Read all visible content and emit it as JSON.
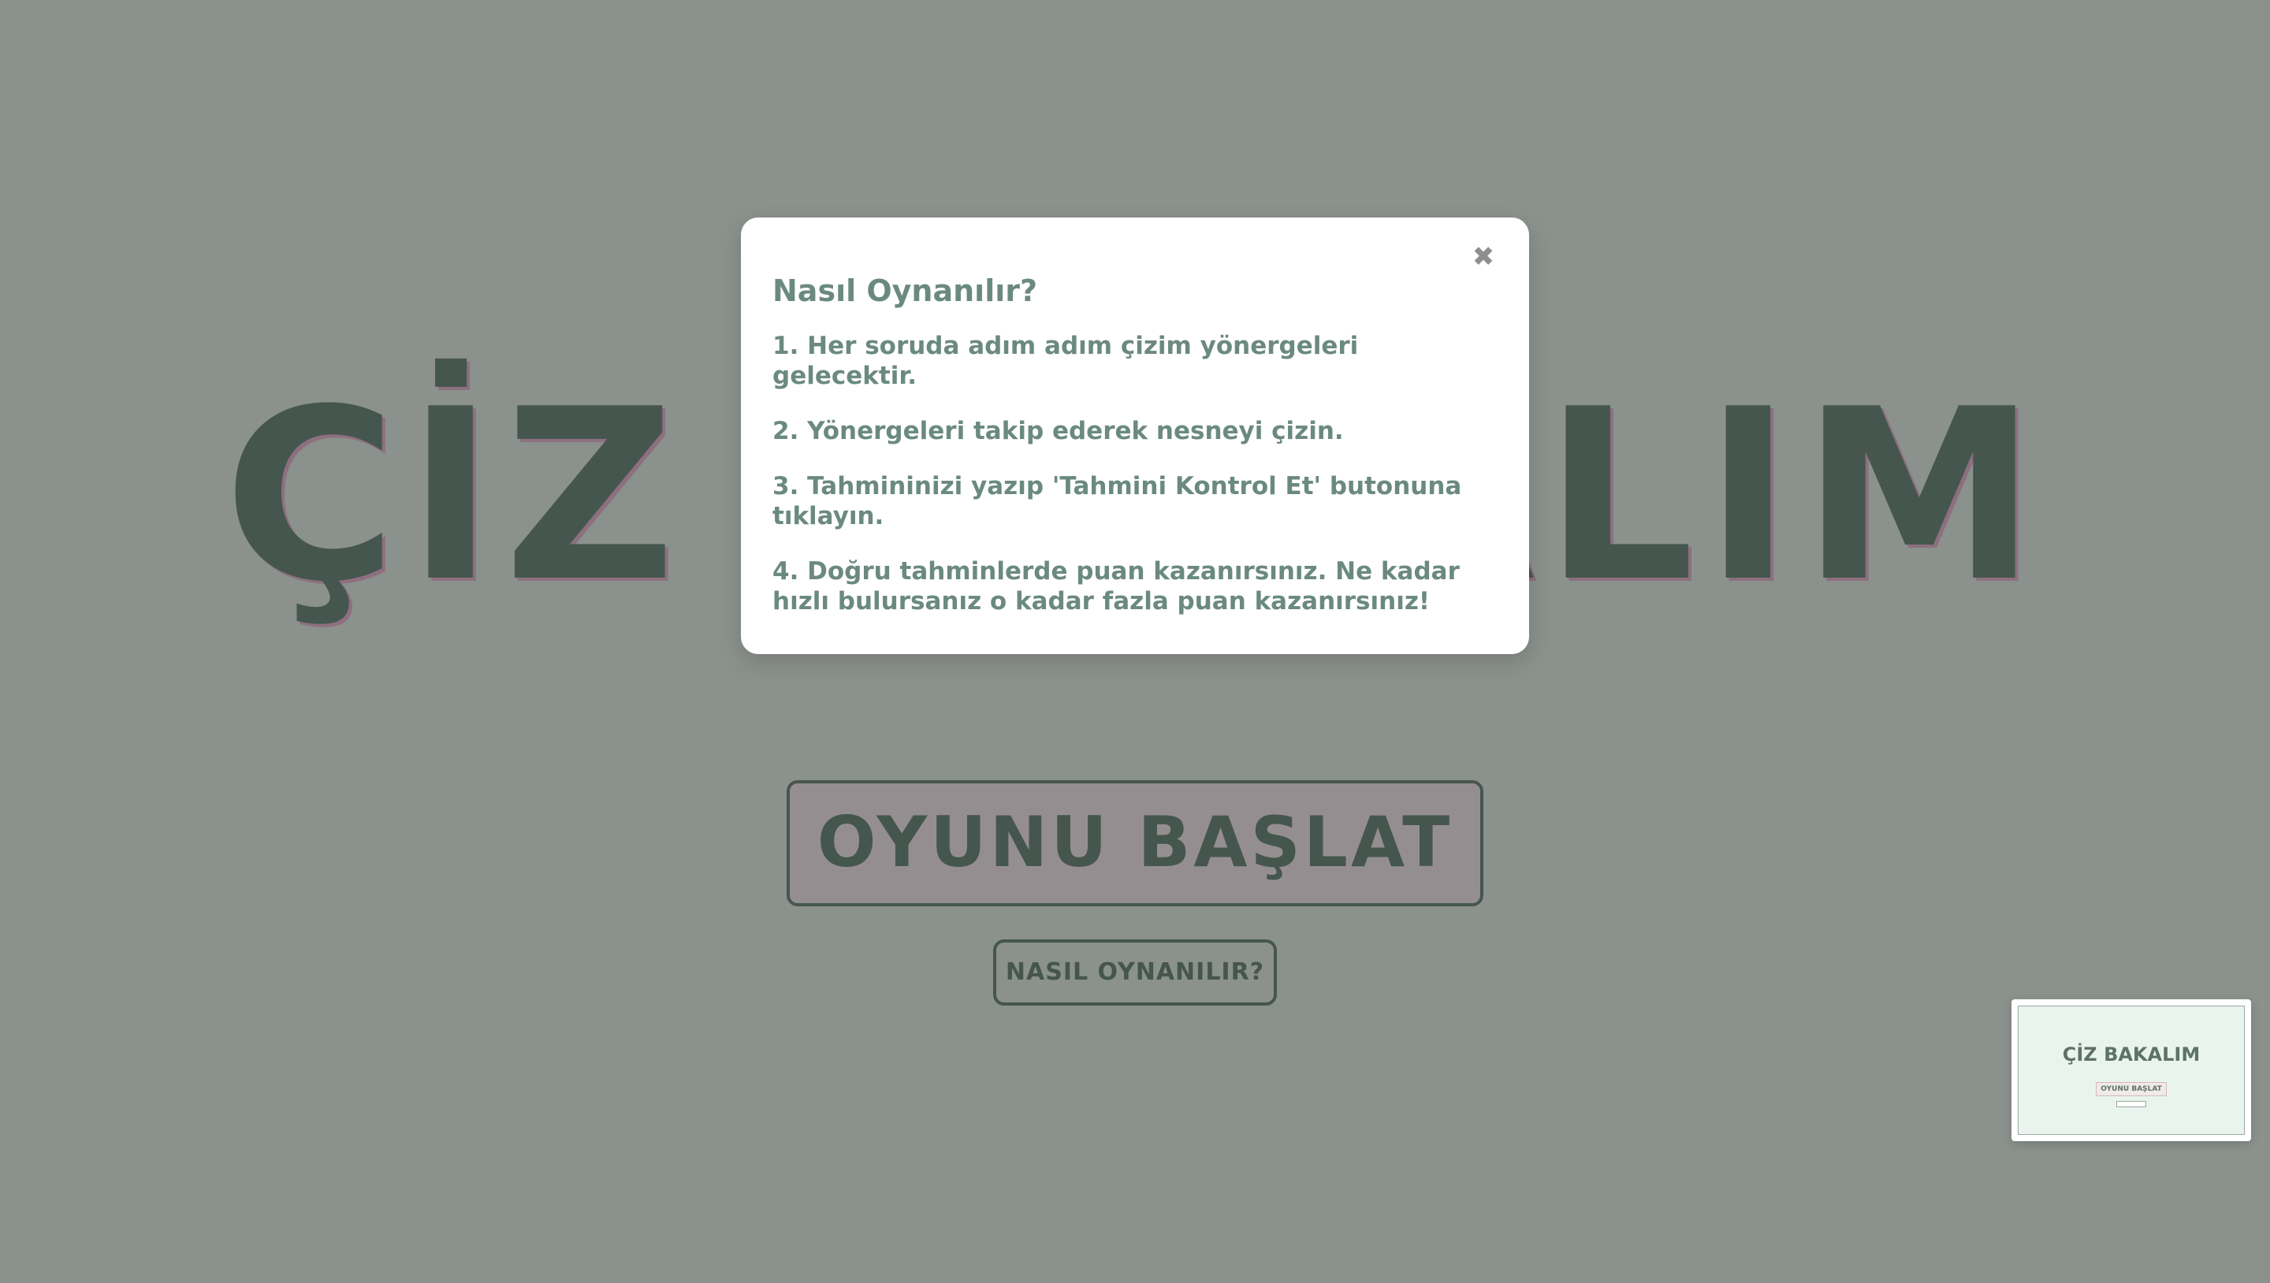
{
  "title": "ÇİZ BAKALIM",
  "buttons": {
    "start_label": "OYUNU BAŞLAT",
    "howto_label": "NASIL OYNANILIR?"
  },
  "modal": {
    "close_icon": "close-icon",
    "close_glyph": "✖",
    "title": "Nasıl Oynanılır?",
    "steps": [
      "1. Her soruda adım adım çizim yönergeleri gelecektir.",
      "2. Yönergeleri takip ederek nesneyi çizin.",
      "3. Tahmininizi yazıp 'Tahmini Kontrol Et' butonuna tıklayın.",
      "4. Doğru tahminlerde puan kazanırsınız. Ne kadar hızlı bulursanız o kadar fazla puan kazanırsınız!"
    ]
  },
  "thumbnail": {
    "title": "ÇİZ BAKALIM",
    "start_label": "OYUNU BAŞLAT"
  },
  "colors": {
    "background": "#8b918c",
    "title": "#45564e",
    "modal_text": "#6b8a7e",
    "start_button_bg": "#958e90"
  }
}
